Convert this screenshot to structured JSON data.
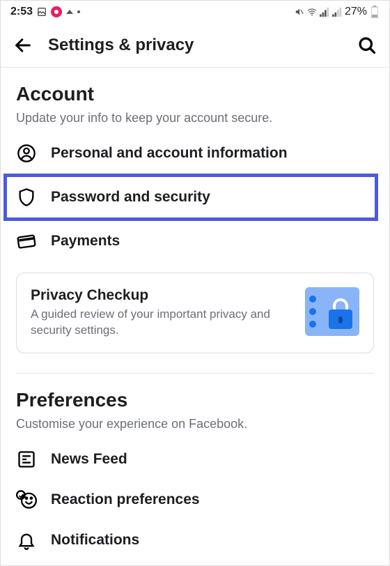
{
  "status_bar": {
    "time": "2:53",
    "battery_pct": "27%"
  },
  "header": {
    "title": "Settings & privacy"
  },
  "sections": {
    "account": {
      "title": "Account",
      "subtitle": "Update your info to keep your account secure.",
      "items": [
        {
          "label": "Personal and account information"
        },
        {
          "label": "Password and security"
        },
        {
          "label": "Payments"
        }
      ]
    },
    "privacy_card": {
      "title": "Privacy Checkup",
      "subtitle": "A guided review of your important privacy and security settings."
    },
    "preferences": {
      "title": "Preferences",
      "subtitle": "Customise your experience on Facebook.",
      "items": [
        {
          "label": "News Feed"
        },
        {
          "label": "Reaction preferences"
        },
        {
          "label": "Notifications"
        }
      ]
    }
  }
}
